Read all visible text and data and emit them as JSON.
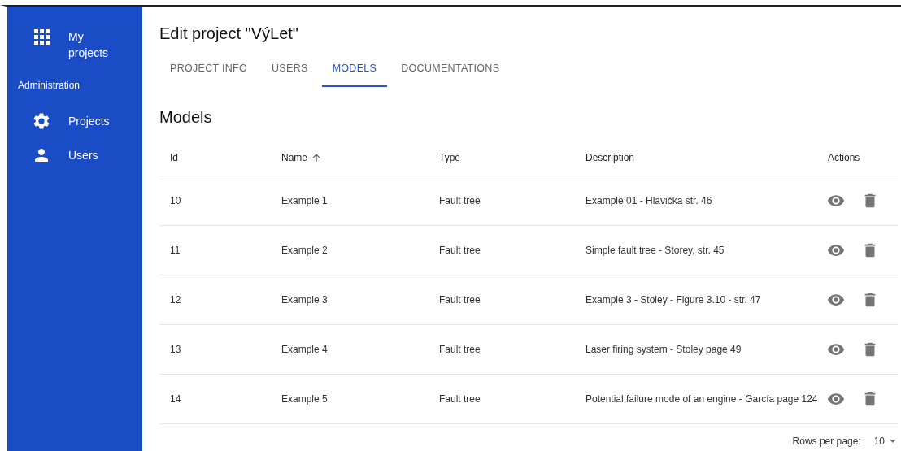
{
  "sidebar": {
    "items": [
      {
        "kind": "apps",
        "label": "My projects"
      },
      {
        "kind": "heading",
        "label": "Administration"
      },
      {
        "kind": "settings",
        "label": "Projects"
      },
      {
        "kind": "person",
        "label": "Users"
      }
    ]
  },
  "page": {
    "title": "Edit project \"VýLet\""
  },
  "tabs": [
    {
      "label": "PROJECT INFO",
      "selected": false
    },
    {
      "label": "USERS",
      "selected": false
    },
    {
      "label": "MODELS",
      "selected": true
    },
    {
      "label": "DOCUMENTATIONS",
      "selected": false
    }
  ],
  "section": {
    "title": "Models"
  },
  "table": {
    "columns": [
      {
        "label": "Id",
        "sorted": false
      },
      {
        "label": "Name",
        "sorted": true
      },
      {
        "label": "Type",
        "sorted": false
      },
      {
        "label": "Description",
        "sorted": false
      },
      {
        "label": "Actions",
        "sorted": false
      }
    ],
    "rows": [
      {
        "id": "10",
        "name": "Example 1",
        "type": "Fault tree",
        "description": "Example 01 - Hlavička str. 46"
      },
      {
        "id": "11",
        "name": "Example 2",
        "type": "Fault tree",
        "description": "Simple fault tree - Storey, str. 45"
      },
      {
        "id": "12",
        "name": "Example 3",
        "type": "Fault tree",
        "description": "Example 3 - Stoley - Figure 3.10 - str. 47"
      },
      {
        "id": "13",
        "name": "Example 4",
        "type": "Fault tree",
        "description": "Laser firing system - Stoley page 49"
      },
      {
        "id": "14",
        "name": "Example 5",
        "type": "Fault tree",
        "description": "Potential failure mode of an engine - García page 124"
      }
    ]
  },
  "pagination": {
    "label": "Rows per page:",
    "value": "10"
  }
}
